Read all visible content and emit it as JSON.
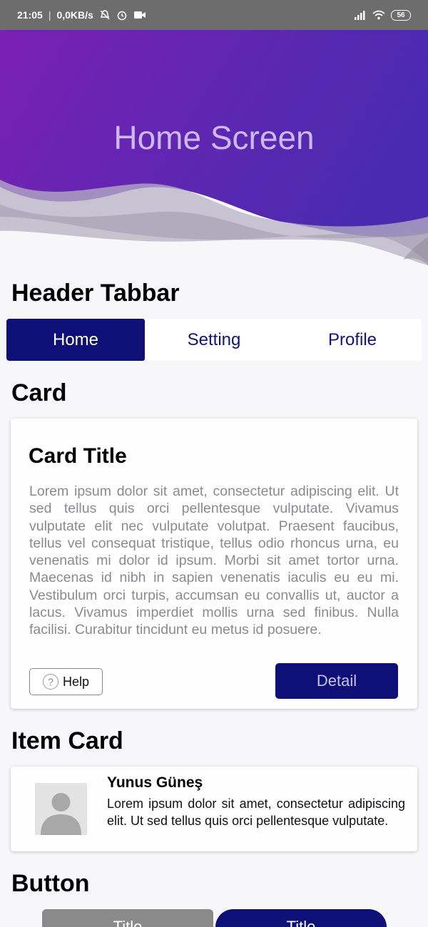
{
  "status_bar": {
    "time": "21:05",
    "network_speed": "0,0KB/s",
    "battery": "56",
    "icons": [
      "mute-icon",
      "alarm-icon",
      "video-icon",
      "signal-icon",
      "wifi-icon",
      "battery-icon"
    ]
  },
  "header": {
    "title": "Home Screen"
  },
  "sections": {
    "tabbar": "Header Tabbar",
    "card": "Card",
    "item_card": "Item Card",
    "button": "Button"
  },
  "tabs": [
    {
      "label": "Home",
      "active": true
    },
    {
      "label": "Setting",
      "active": false
    },
    {
      "label": "Profile",
      "active": false
    }
  ],
  "card": {
    "title": "Card Title",
    "body": "Lorem ipsum dolor sit amet, consectetur adipiscing elit. Ut sed tellus quis orci pellentesque vulputate. Vivamus vulputate elit nec vulputate volutpat. Praesent faucibus, tellus vel consequat tristique, tellus odio rhoncus urna, eu venenatis mi dolor id ipsum. Morbi sit amet tortor urna. Maecenas id nibh in sapien venenatis iaculis eu eu mi. Vestibulum orci turpis, accumsan eu convallis ut, auctor a lacus. Vivamus imperdiet mollis urna sed finibus. Nulla facilisi. Curabitur tincidunt eu metus id posuere.",
    "help_label": "Help",
    "detail_label": "Detail"
  },
  "item_card": {
    "name": "Yunus Güneş",
    "description": "Lorem ipsum dolor sit amet, consectetur adipiscing elit. Ut sed tellus quis orci pellentesque vulputate."
  },
  "buttons": {
    "grey_label": "Title",
    "navy_label": "Title"
  },
  "colors": {
    "primary": "#0f0f78",
    "header_gradient_start": "#7a20b3",
    "header_gradient_end": "#4a2bb0",
    "background": "#f7f6f9"
  }
}
